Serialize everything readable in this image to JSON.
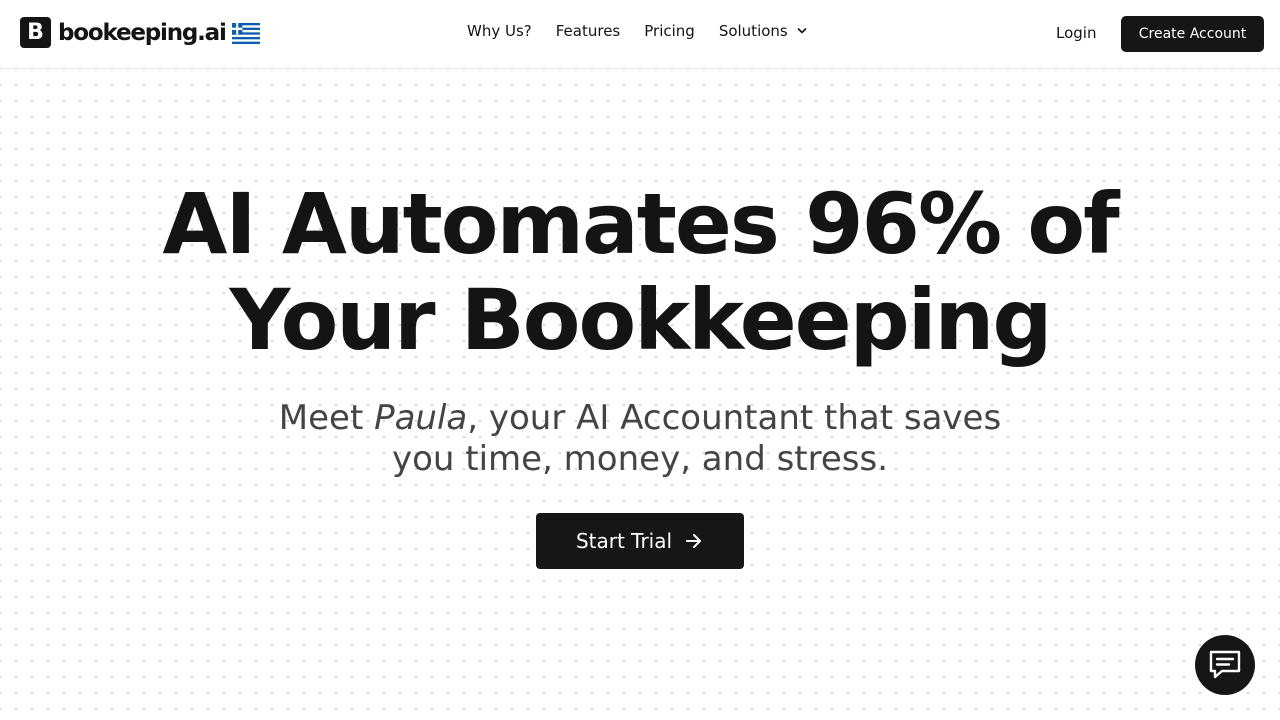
{
  "header": {
    "logo_mark": "B",
    "logo_text": "bookeeping.ai",
    "nav": [
      {
        "label": "Why Us?"
      },
      {
        "label": "Features"
      },
      {
        "label": "Pricing"
      },
      {
        "label": "Solutions"
      }
    ],
    "login_label": "Login",
    "create_account_label": "Create Account"
  },
  "hero": {
    "headline_line1": "AI Automates 96% of",
    "headline_line2": "Your Bookkeeping",
    "sub_meet": "Meet ",
    "sub_name": "Paula",
    "sub_rest_line1": ", your AI Accountant that saves",
    "sub_line2": "you time, money, and stress.",
    "cta_label": "Start Trial"
  },
  "icons": {
    "flag": "greece-flag-icon",
    "solutions_chevron": "chevron-down-icon",
    "cta_arrow": "arrow-right-icon",
    "chat": "chat-icon"
  },
  "colors": {
    "primary_dark": "#161616",
    "text": "#141414",
    "subtext": "#444444",
    "flag_blue": "#0D5EAF",
    "dot_grid": "#d3d3d3"
  }
}
